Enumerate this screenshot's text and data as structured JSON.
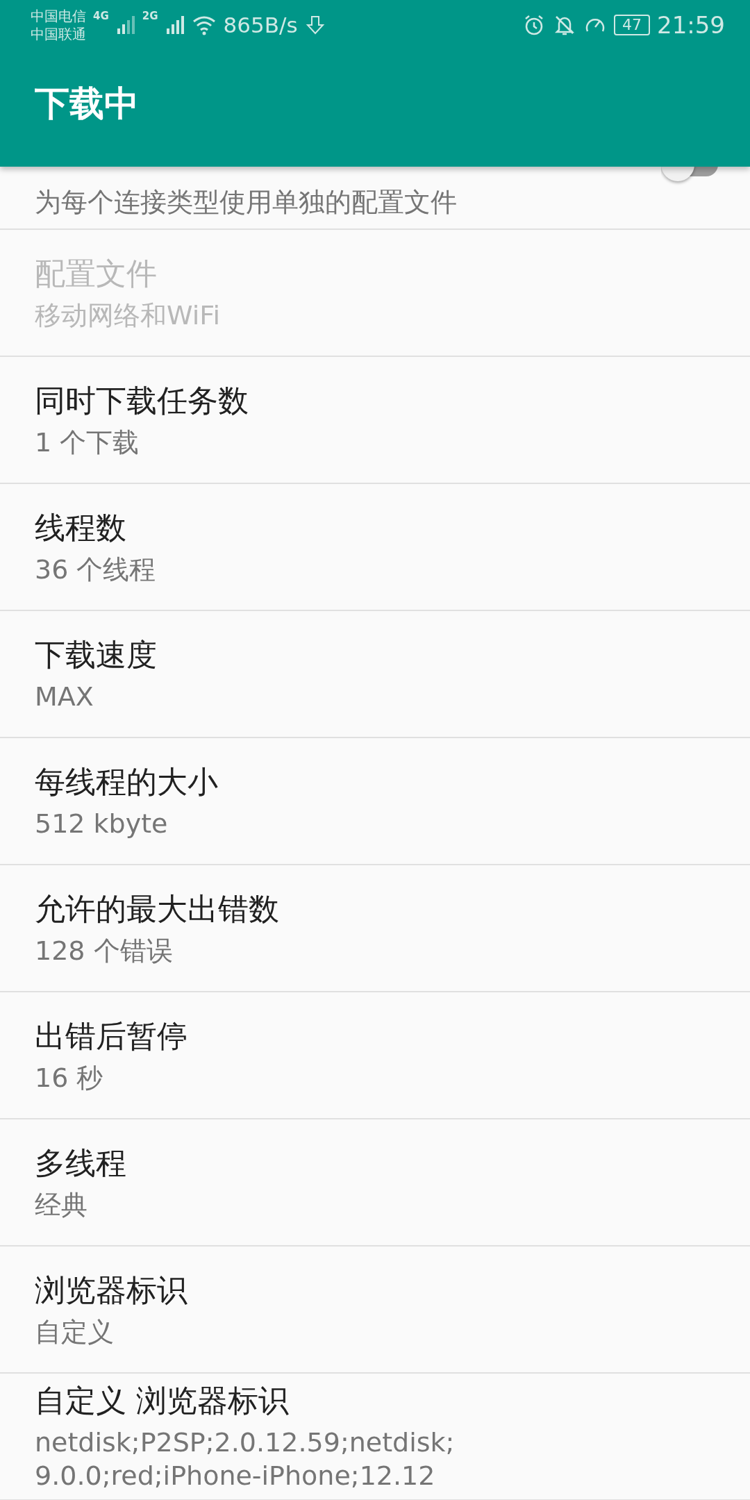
{
  "status_bar": {
    "carrier_1": "中国电信",
    "carrier_2": "中国联通",
    "network_1": "4G",
    "network_2": "2G",
    "speed": "865B/s",
    "battery": "47",
    "time": "21:59"
  },
  "app_bar": {
    "title": "下载中"
  },
  "partial_item": {
    "summary": "为每个连接类型使用单独的配置文件",
    "switch": {
      "on": false
    }
  },
  "settings": [
    {
      "title": "配置文件",
      "summary": "移动网络和WiFi",
      "disabled": true
    },
    {
      "title": "同时下载任务数",
      "summary": "1 个下载",
      "disabled": false
    },
    {
      "title": "线程数",
      "summary": "36 个线程",
      "disabled": false
    },
    {
      "title": "下载速度",
      "summary": "MAX",
      "disabled": false
    },
    {
      "title": "每线程的大小",
      "summary": "512 kbyte",
      "disabled": false
    },
    {
      "title": "允许的最大出错数",
      "summary": "128 个错误",
      "disabled": false
    },
    {
      "title": "出错后暂停",
      "summary": "16 秒",
      "disabled": false
    },
    {
      "title": "多线程",
      "summary": "经典",
      "disabled": false
    },
    {
      "title": "浏览器标识",
      "summary": "自定义",
      "disabled": false
    },
    {
      "title": "自定义 浏览器标识",
      "summary": "netdisk;P2SP;2.0.12.59;netdisk;\n9.0.0;red;iPhone-iPhone;12.12",
      "disabled": false
    }
  ]
}
